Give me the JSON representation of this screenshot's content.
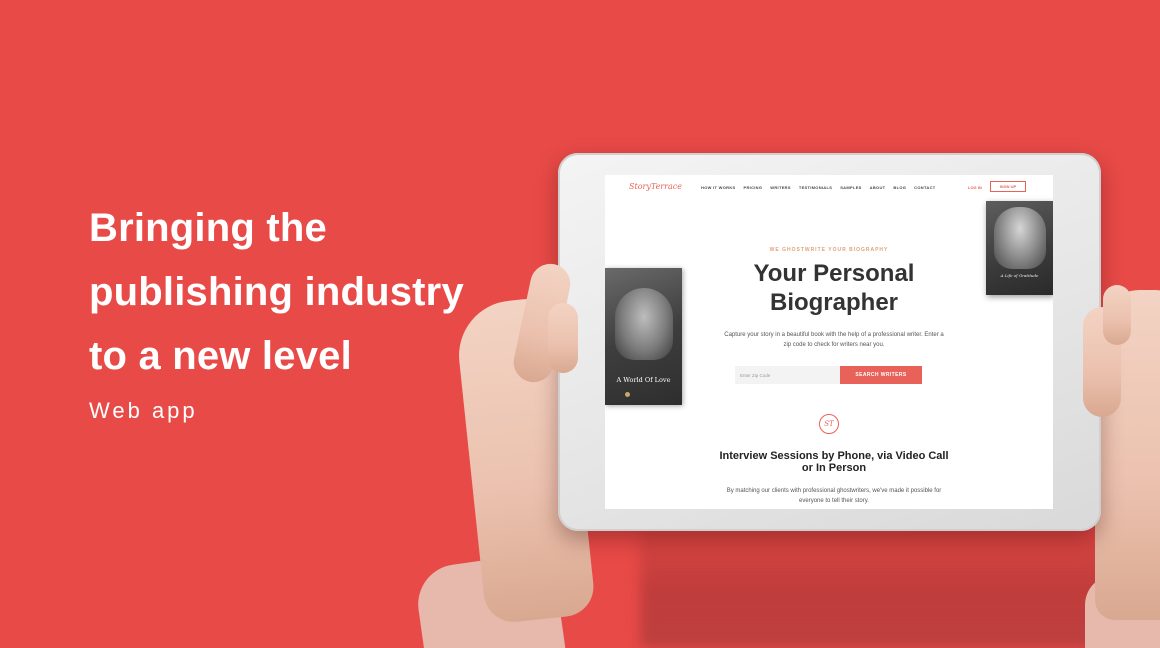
{
  "headline": {
    "line1": "Bringing the",
    "line2": "publishing industry",
    "line3": "to a new level"
  },
  "subline": "Web app",
  "site": {
    "logo": "StoryTerrace",
    "nav": [
      "HOW IT WORKS",
      "PRICING",
      "WRITERS",
      "TESTIMONIALS",
      "SAMPLES",
      "ABOUT",
      "BLOG",
      "CONTACT"
    ],
    "login": "LOG IN",
    "signup": "SIGN UP",
    "kicker": "WE GHOSTWRITE YOUR BIOGRAPHY",
    "hero_title_line1": "Your Personal",
    "hero_title_line2": "Biographer",
    "hero_desc": "Capture your story in a beautiful book with the help of a professional writer. Enter a zip code to check for writers near you.",
    "zip_placeholder": "Enter Zip Code",
    "search_button": "SEARCH WRITERS",
    "seal": "ST",
    "section_title": "Interview Sessions by Phone, via Video Call or In Person",
    "section_desc": "By matching our clients with professional ghostwriters, we've made it possible for everyone to tell their story.",
    "book_left_title": "A World Of Love",
    "book_right_title": "A Life of Gratitude"
  },
  "colors": {
    "background": "#E84A47",
    "accent": "#E8625A"
  }
}
